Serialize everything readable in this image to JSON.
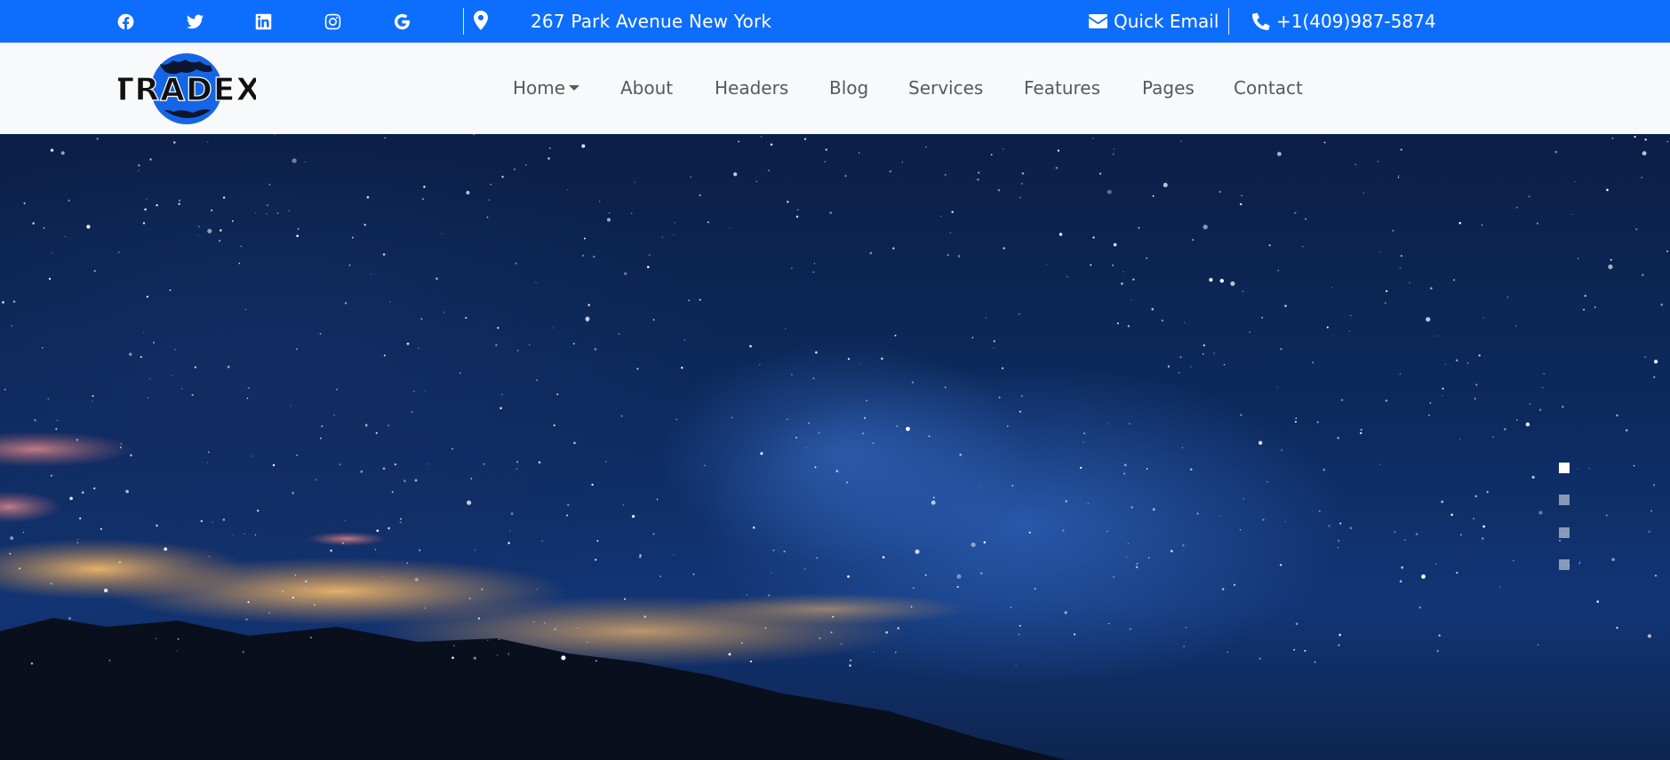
{
  "topbar": {
    "social_icons": [
      "facebook-icon",
      "twitter-icon",
      "linkedin-icon",
      "instagram-icon",
      "google-icon"
    ],
    "address_icon": "map-pin-icon",
    "address": "267 Park Avenue New York",
    "email_icon": "envelope-icon",
    "email_label": "Quick Email",
    "phone_icon": "phone-icon",
    "phone": "+1(409)987-5874",
    "background_color": "#0d6efd"
  },
  "navbar": {
    "logo_text": "TRADEX",
    "items": [
      {
        "label": "Home",
        "has_dropdown": true
      },
      {
        "label": "About"
      },
      {
        "label": "Headers"
      },
      {
        "label": "Blog"
      },
      {
        "label": "Services"
      },
      {
        "label": "Features"
      },
      {
        "label": "Pages"
      },
      {
        "label": "Contact"
      }
    ]
  },
  "hero": {
    "slider_indicators": 4,
    "active_indicator": 1
  }
}
